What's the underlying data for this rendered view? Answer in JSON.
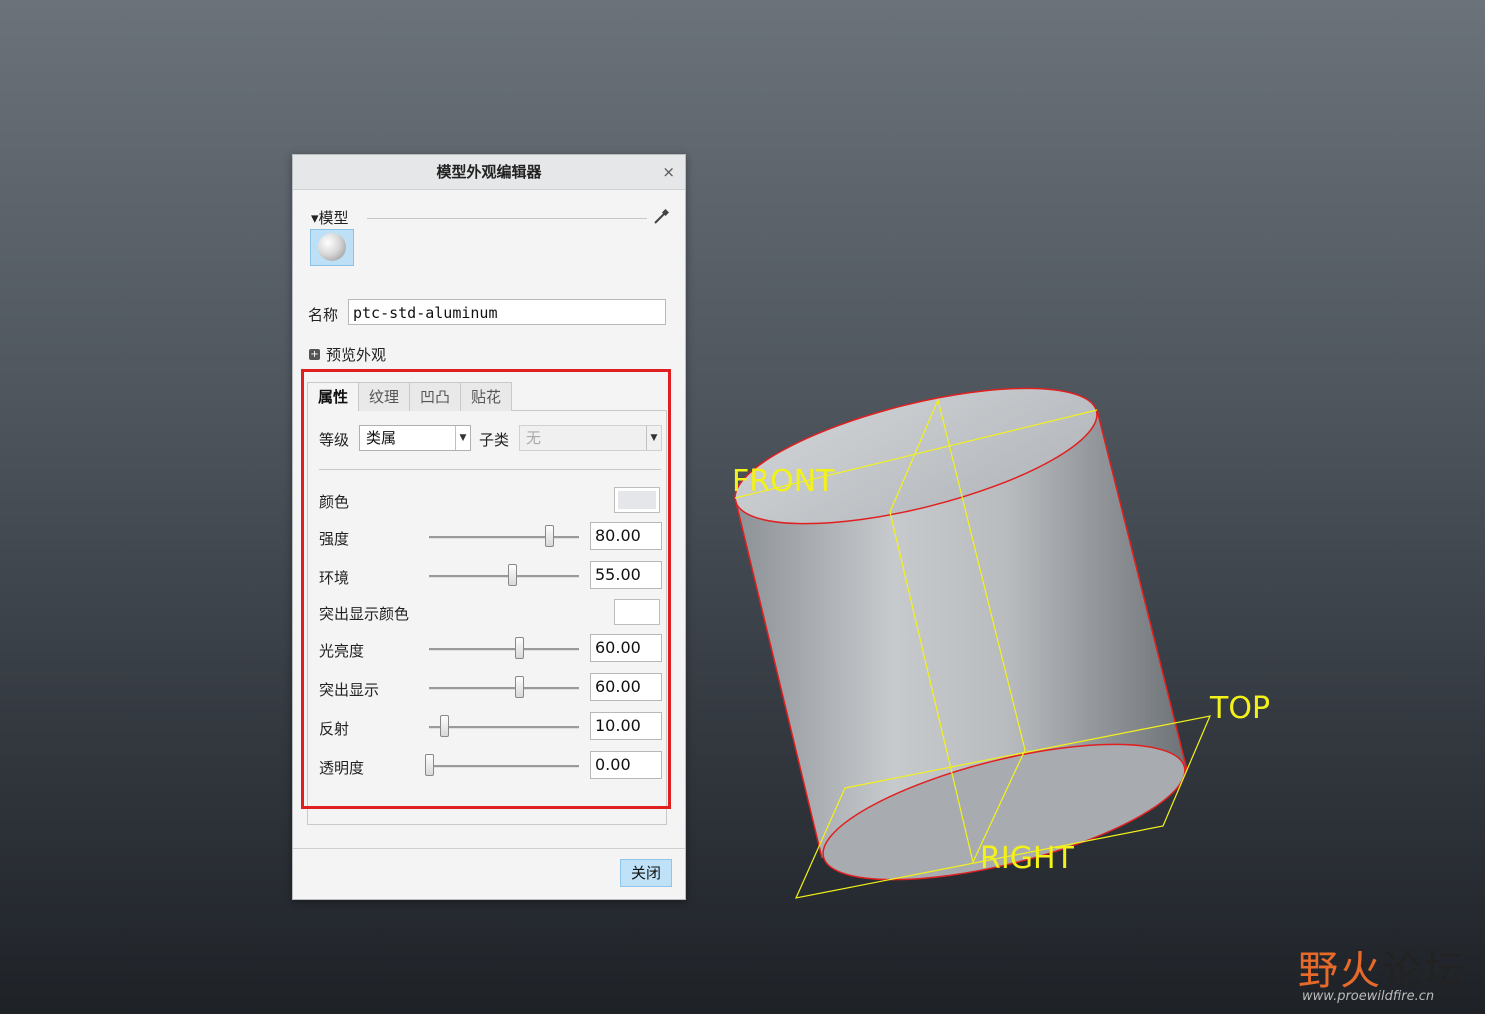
{
  "dialog": {
    "title": "模型外观编辑器",
    "close_glyph": "×",
    "section_model": "▾模型",
    "name_label": "名称",
    "name_value": "ptc-std-aluminum",
    "preview_label": "预览外观",
    "tabs": [
      "属性",
      "纹理",
      "凹凸",
      "贴花"
    ],
    "level_label": "等级",
    "level_value": "类属",
    "subclass_label": "子类",
    "subclass_value": "无",
    "color_label": "颜色",
    "properties": [
      {
        "label": "强度",
        "value": "80.00",
        "level": 0.8
      },
      {
        "label": "环境",
        "value": "55.00",
        "level": 0.55
      },
      {
        "label": "光亮度",
        "value": "60.00",
        "level": 0.6
      },
      {
        "label": "突出显示",
        "value": "60.00",
        "level": 0.6
      },
      {
        "label": "反射",
        "value": "10.00",
        "level": 0.1
      },
      {
        "label": "透明度",
        "value": "0.00",
        "level": 0.0
      }
    ],
    "highlight_color_label": "突出显示颜色",
    "close_button": "关闭"
  },
  "viewport": {
    "datum_labels": {
      "front": "FRONT",
      "top": "TOP",
      "right": "RIGHT"
    }
  },
  "watermark": {
    "cn_1": "野火",
    "cn_2": "论坛",
    "url": "www.proewildfire.cn"
  },
  "colors": {
    "datum_yellow": "#f2f21a",
    "edge_red": "#e02020",
    "accent_blue": "#bfe2f8"
  }
}
